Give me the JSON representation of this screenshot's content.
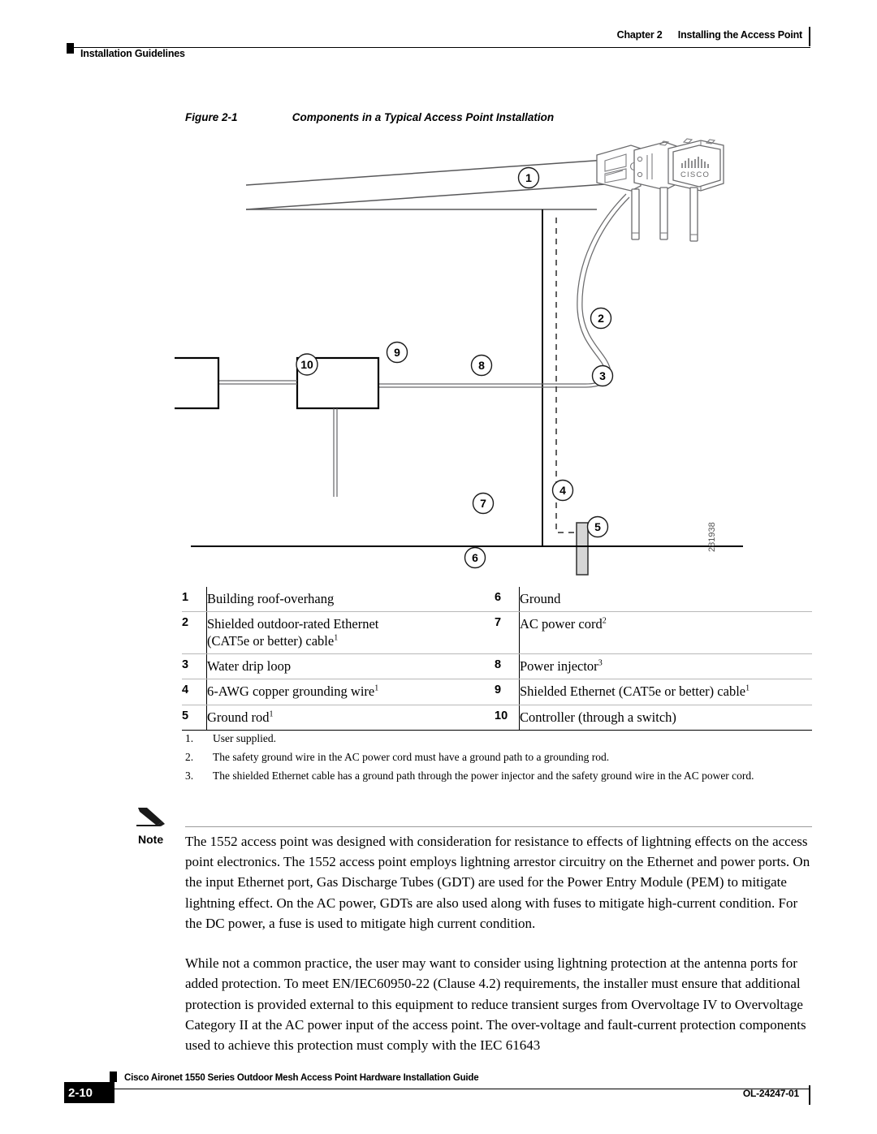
{
  "header": {
    "chapter": "Chapter 2",
    "chapter_title": "Installing the Access Point",
    "section": "Installation Guidelines"
  },
  "figure": {
    "number": "Figure 2-1",
    "title": "Components in a Typical Access Point Installation",
    "graphic_id": "281938",
    "device_brand": "CISCO",
    "callouts": [
      "1",
      "2",
      "3",
      "4",
      "5",
      "6",
      "7",
      "8",
      "9",
      "10"
    ]
  },
  "legend": {
    "rows": [
      {
        "left_num": "1",
        "left_text": "Building roof-overhang",
        "left_sup": "",
        "left_text2": "",
        "left_sup2": "",
        "right_num": "6",
        "right_text": "Ground",
        "right_sup": ""
      },
      {
        "left_num": "2",
        "left_text": "Shielded outdoor-rated Ethernet",
        "left_sup": "",
        "left_text2": "(CAT5e or better) cable",
        "left_sup2": "1",
        "right_num": "7",
        "right_text": "AC power cord",
        "right_sup": "2"
      },
      {
        "left_num": "3",
        "left_text": "Water drip loop",
        "left_sup": "",
        "left_text2": "",
        "left_sup2": "",
        "right_num": "8",
        "right_text": "Power injector",
        "right_sup": "3"
      },
      {
        "left_num": "4",
        "left_text": "6-AWG copper grounding wire",
        "left_sup": "1",
        "left_text2": "",
        "left_sup2": "",
        "right_num": "9",
        "right_text": "Shielded Ethernet (CAT5e or better) cable",
        "right_sup": "1"
      },
      {
        "left_num": "5",
        "left_text": "Ground rod",
        "left_sup": "1",
        "left_text2": "",
        "left_sup2": "",
        "right_num": "10",
        "right_text": "Controller (through a switch)",
        "right_sup": ""
      }
    ]
  },
  "footnotes": [
    {
      "mark": "1.",
      "text": "User supplied."
    },
    {
      "mark": "2.",
      "text": "The safety ground wire in the AC power cord must have a ground path to a grounding rod."
    },
    {
      "mark": "3.",
      "text": "The shielded Ethernet cable has a ground path through the power injector and the safety ground wire in the AC power cord."
    }
  ],
  "note": {
    "label": "Note",
    "paragraphs": [
      "The 1552 access point was designed with consideration for resistance to effects of lightning effects on the access point electronics. The 1552 access point employs lightning arrestor circuitry on the Ethernet and power ports. On the input Ethernet port, Gas Discharge Tubes (GDT) are used for the Power Entry Module (PEM) to mitigate lightning effect. On the AC power, GDTs are also used along with fuses to mitigate high-current condition. For the DC power, a fuse is used to mitigate high current condition.",
      "While not a common practice, the user may want to consider using lightning protection at the antenna ports for added protection. To meet EN/IEC60950-22 (Clause 4.2) requirements, the installer must ensure that additional protection is provided external to this equipment to reduce transient surges from Overvoltage IV to Overvoltage Category II at the AC power input of the access point. The over-voltage and fault-current protection components used to achieve this protection must comply with the IEC 61643"
    ]
  },
  "footer": {
    "page": "2-10",
    "title": "Cisco Aironet 1550 Series Outdoor Mesh Access Point Hardware Installation Guide",
    "doc_id": "OL-24247-01"
  },
  "colors": {
    "ink": "#000000",
    "line_gray": "#58585a",
    "rod_fill": "#d6d6d6",
    "rule_gray": "#b8b8b8"
  }
}
